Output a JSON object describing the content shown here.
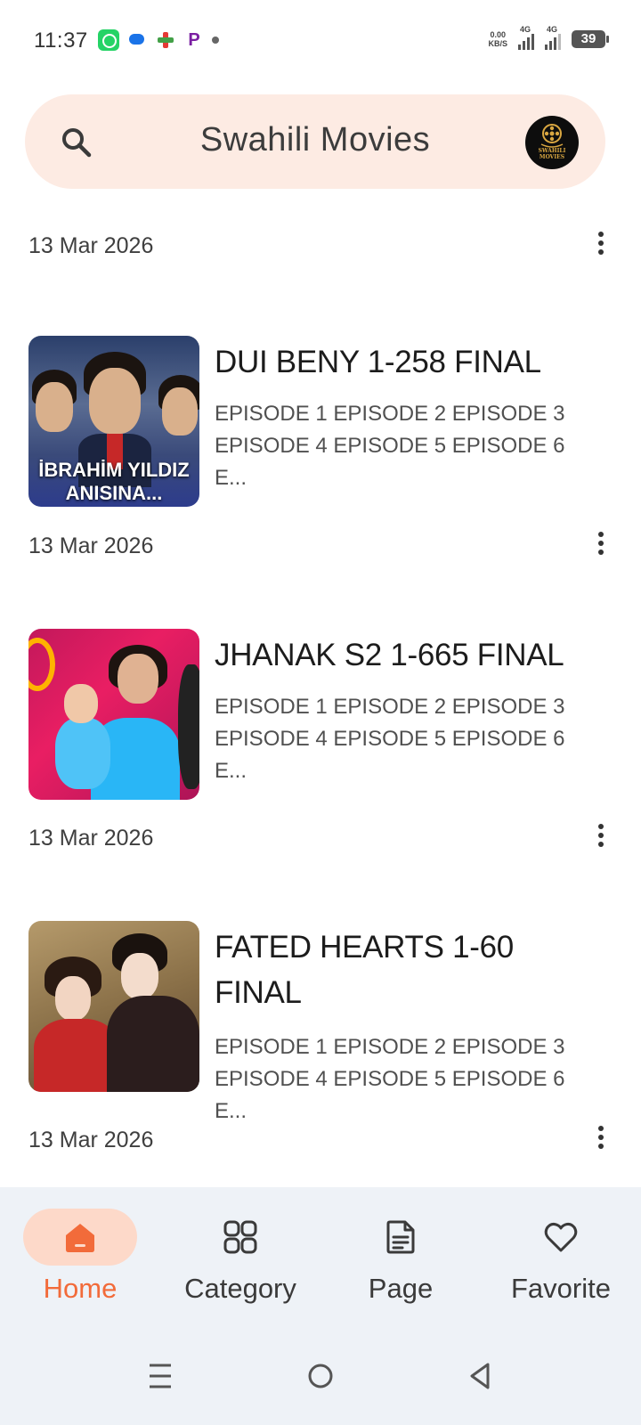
{
  "status_bar": {
    "time": "11:37",
    "net_speed_value": "0.00",
    "net_speed_unit": "KB/S",
    "signal1_label": "4G",
    "signal2_label": "4G",
    "battery": "39"
  },
  "header": {
    "title": "Swahili Movies",
    "logo_text": "SWAHILI MOVIES",
    "accent_bg": "#fdebe3"
  },
  "feed": {
    "top_date": "13 Mar 2026",
    "posts": [
      {
        "title": "DUI BENY 1-258 FINAL",
        "description": "EPISODE 1 EPISODE 2 EPISODE 3 EPISODE 4 EPISODE 5 EPISODE 6 E...",
        "thumb_caption": "İBRAHİM YILDIZ ANISINA...",
        "date": "13 Mar 2026"
      },
      {
        "title": "JHANAK S2 1-665 FINAL",
        "description": "EPISODE 1 EPISODE 2 EPISODE 3 EPISODE 4 EPISODE 5 EPISODE 6 E...",
        "date": "13 Mar 2026"
      },
      {
        "title": "FATED HEARTS 1-60 FINAL",
        "description": "EPISODE 1 EPISODE 2 EPISODE 3 EPISODE 4 EPISODE 5 EPISODE 6 E...",
        "date": "13 Mar 2026"
      }
    ]
  },
  "bottom_nav": {
    "active_color": "#f26b3a",
    "items": [
      {
        "label": "Home",
        "icon": "home-icon",
        "active": true
      },
      {
        "label": "Category",
        "icon": "grid-icon",
        "active": false
      },
      {
        "label": "Page",
        "icon": "document-icon",
        "active": false
      },
      {
        "label": "Favorite",
        "icon": "heart-icon",
        "active": false
      }
    ]
  },
  "system_nav": {
    "buttons": [
      "menu-icon",
      "home-circle-icon",
      "back-triangle-icon"
    ]
  }
}
